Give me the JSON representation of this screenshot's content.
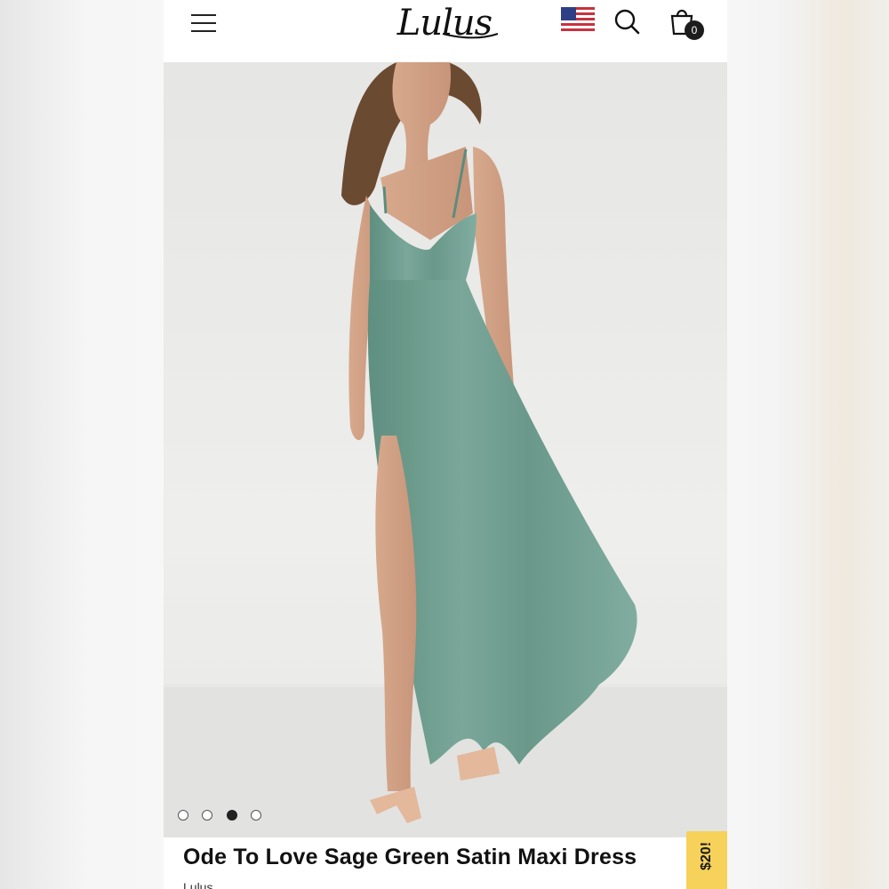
{
  "header": {
    "menu_icon": "hamburger-menu-icon",
    "logo_text": "Lulus",
    "flag_icon": "us-flag-icon",
    "search_icon": "search-icon",
    "cart_icon": "shopping-bag-icon",
    "cart_count": "0"
  },
  "gallery": {
    "image_description_icon": "product-photo",
    "dress_color": "#6e9b8d",
    "dots": [
      {
        "active": false
      },
      {
        "active": false
      },
      {
        "active": true
      },
      {
        "active": false
      }
    ]
  },
  "product": {
    "title": "Ode To Love Sage Green Satin Maxi Dress",
    "brand": "Lulus"
  },
  "price_tag": {
    "label": "$20!",
    "color": "#f6d25a"
  }
}
